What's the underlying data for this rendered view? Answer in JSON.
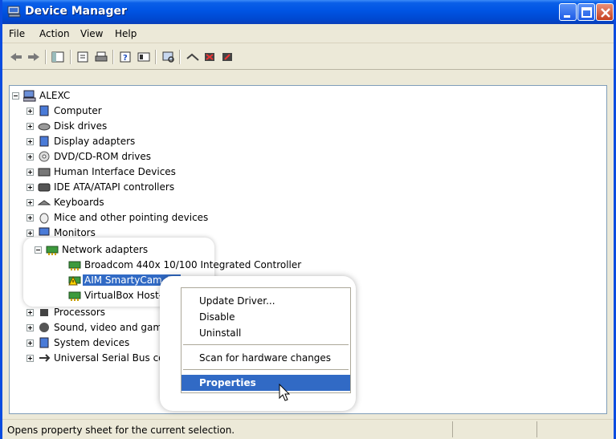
{
  "window": {
    "title": "Device Manager"
  },
  "menu": [
    "File",
    "Action",
    "View",
    "Help"
  ],
  "toolbar": {
    "icons": [
      "back-arrow-icon",
      "forward-arrow-icon",
      "console-tree-icon",
      "properties-icon",
      "print-icon",
      "help-icon",
      "view-icon",
      "scan-hardware-icon",
      "update-driver-icon",
      "uninstall-icon",
      "disable-icon"
    ]
  },
  "tree": {
    "root": "ALEXC",
    "categories": [
      "Computer",
      "Disk drives",
      "Display adapters",
      "DVD/CD-ROM drives",
      "Human Interface Devices",
      "IDE ATA/ATAPI controllers",
      "Keyboards",
      "Mice and other pointing devices",
      "Monitors"
    ],
    "network": {
      "label": "Network adapters",
      "children": [
        "Broadcom 440x 10/100 Integrated Controller",
        "AIM SmartyCam #2",
        "VirtualBox Host-Onl"
      ]
    },
    "after": [
      "Processors",
      "Sound, video and game",
      "System devices",
      "Universal Serial Bus con"
    ]
  },
  "context_menu": {
    "items": [
      "Update Driver...",
      "Disable",
      "Uninstall",
      "Scan for hardware changes",
      "Properties"
    ]
  },
  "status": {
    "text": "Opens property sheet for the current selection."
  },
  "colors": {
    "title_blue": "#0054e3",
    "selection": "#316ac5"
  }
}
